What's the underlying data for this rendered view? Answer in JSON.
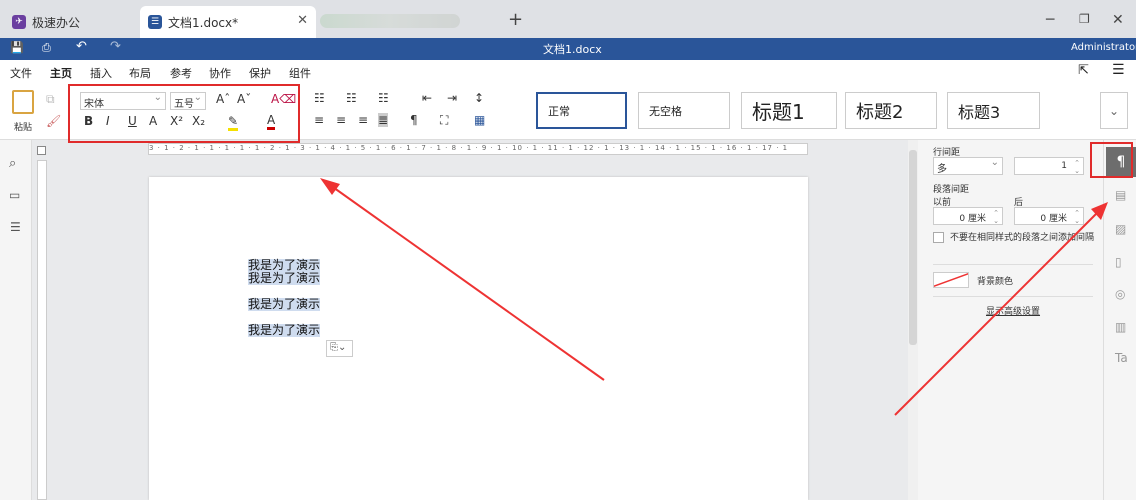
{
  "tabs": {
    "app_tab": "极速办公",
    "doc_tab": "文档1.docx*"
  },
  "titlebar": {
    "doc_title": "文档1.docx",
    "user": "Administrator"
  },
  "menu": [
    "文件",
    "主页",
    "插入",
    "布局",
    "参考",
    "协作",
    "保护",
    "组件"
  ],
  "ribbon": {
    "paste_label": "粘贴",
    "font_name": "宋体",
    "font_size": "五号",
    "styles": [
      "正常",
      "无空格",
      "标题1",
      "标题2",
      "标题3"
    ]
  },
  "document": {
    "lines": [
      "我是为了演示",
      "我是为了演示",
      "我是为了演示",
      "我是为了演示"
    ]
  },
  "ruler": "3 · 1 · 2 · 1 · 1 · 1 · 1 · 1 · 2 · 1 · 3 · 1 · 4 · 1 · 5 · 1 · 6 · 1 · 7 · 1 · 8 · 1 · 9 · 1 · 10 · 1 · 11 · 1 · 12 · 1 · 13 · 1 · 14 · 1 · 15 · 1 · 16 · 1 · 17 · 1",
  "paragraph_panel": {
    "line_spacing_label": "行间距",
    "line_spacing_mode": "多",
    "line_spacing_value": "1",
    "para_spacing_label": "段落间距",
    "before_label": "以前",
    "after_label": "后",
    "before_value": "0 厘米",
    "after_value": "0 厘米",
    "no_space_label": "不要在相同样式的段落之间添加间隔",
    "bg_color_label": "背景颜色",
    "advanced_link": "显示高级设置"
  },
  "colors": {
    "accent": "#2a5599",
    "highlight": "#e02b2b",
    "selection": "#cfdcef"
  }
}
